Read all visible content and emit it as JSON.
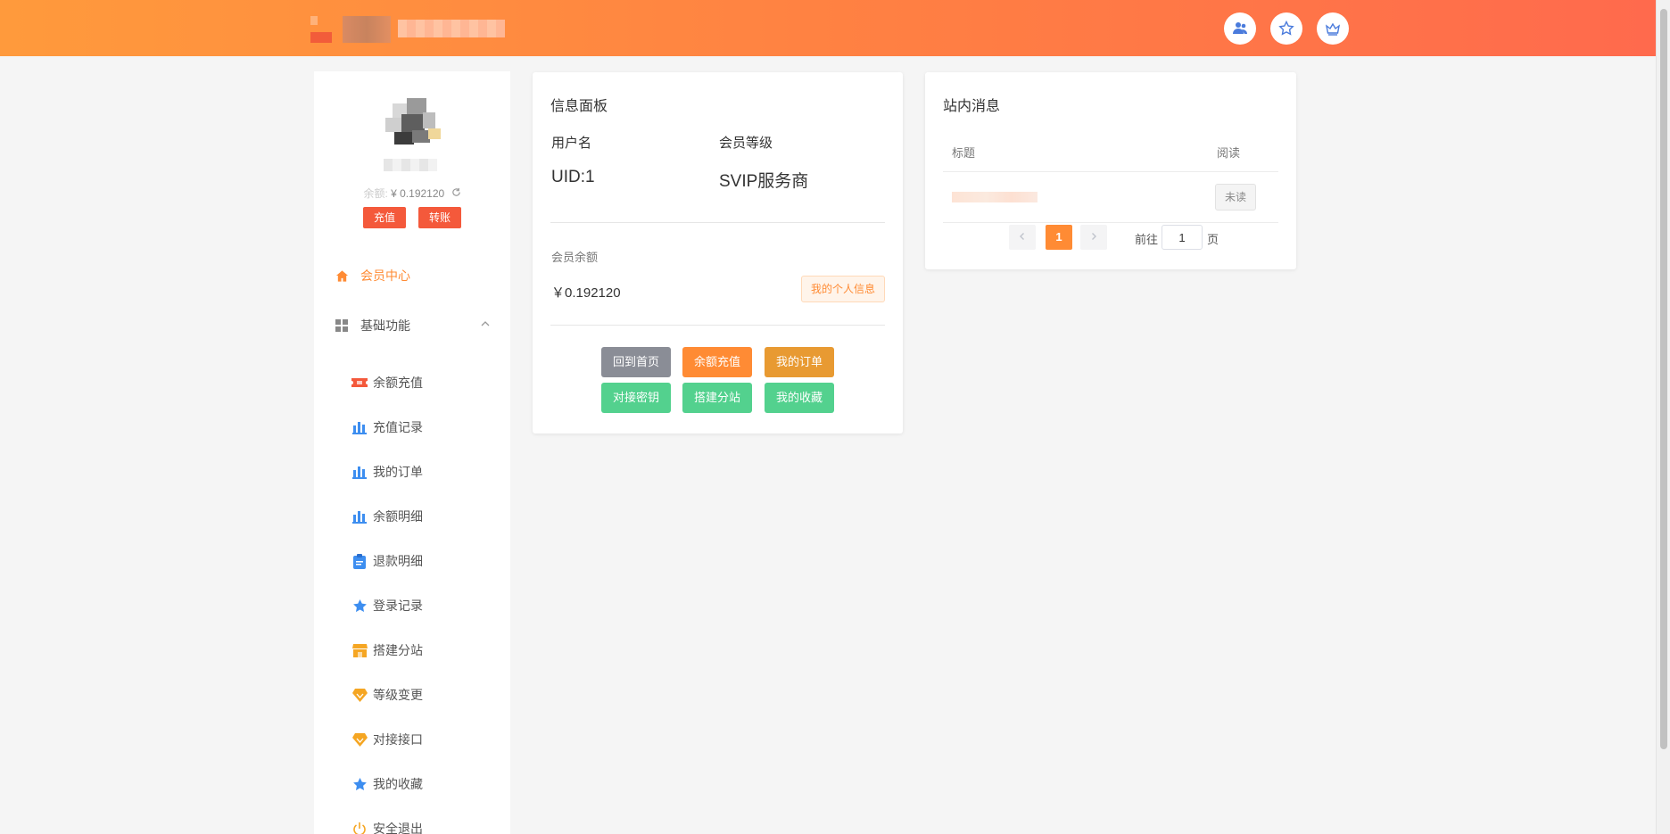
{
  "header": {
    "icons": [
      "user-group-icon",
      "star-icon",
      "crown-icon"
    ],
    "brand_color": "#ff8b34"
  },
  "sidebar": {
    "balance_text": "¥ 0.192120",
    "recharge_label": "充值",
    "transfer_label": "转账",
    "menu": {
      "member_center": "会员中心",
      "basic_functions": "基础功能"
    },
    "sub_items": [
      {
        "label": "余额充值",
        "icon": "ticket-icon"
      },
      {
        "label": "充值记录",
        "icon": "bar-chart-icon"
      },
      {
        "label": "我的订单",
        "icon": "bar-chart-icon"
      },
      {
        "label": "余额明细",
        "icon": "bar-chart-icon"
      },
      {
        "label": "退款明细",
        "icon": "clipboard-icon"
      },
      {
        "label": "登录记录",
        "icon": "star-icon"
      },
      {
        "label": "搭建分站",
        "icon": "store-icon"
      },
      {
        "label": "等级变更",
        "icon": "diamond-icon"
      },
      {
        "label": "对接接口",
        "icon": "diamond-icon"
      },
      {
        "label": "我的收藏",
        "icon": "star-icon"
      },
      {
        "label": "安全退出",
        "icon": "power-icon"
      }
    ]
  },
  "info_panel": {
    "title": "信息面板",
    "username_label": "用户名",
    "level_label": "会员等级",
    "uid": "UID:1",
    "level_value": "SVIP服务商",
    "balance_label": "会员余额",
    "balance_value": "￥0.192120",
    "profile_button": "我的个人信息",
    "actions": [
      {
        "label": "回到首页",
        "color": "#8a8d96"
      },
      {
        "label": "余额充值",
        "color": "#ff8b34"
      },
      {
        "label": "我的订单",
        "color": "#e89a32"
      },
      {
        "label": "对接密钥",
        "color": "#53d18e"
      },
      {
        "label": "搭建分站",
        "color": "#53d18e"
      },
      {
        "label": "我的收藏",
        "color": "#53d18e"
      }
    ]
  },
  "messages": {
    "title": "站内消息",
    "col_title": "标题",
    "col_read": "阅读",
    "unread_label": "未读",
    "pagination": {
      "current": "1",
      "goto_label": "前往",
      "page_value": "1",
      "page_suffix": "页"
    }
  }
}
